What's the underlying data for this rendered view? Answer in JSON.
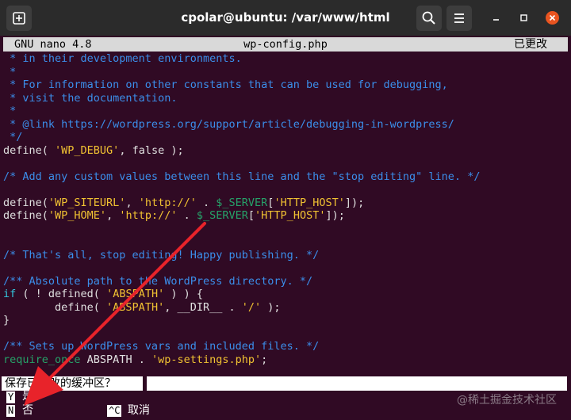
{
  "window": {
    "title": "cpolar@ubuntu: /var/www/html",
    "icons": [
      "new-tab-icon",
      "search-icon",
      "hamburger-menu-icon",
      "minimize-icon",
      "maximize-icon",
      "close-icon"
    ]
  },
  "nano": {
    "version": "GNU nano 4.8",
    "filename": "wp-config.php",
    "modified": "已更改"
  },
  "code_lines": [
    {
      "parts": [
        {
          "c": "cm",
          "t": " * in their development environments."
        }
      ]
    },
    {
      "parts": [
        {
          "c": "cm",
          "t": " *"
        }
      ]
    },
    {
      "parts": [
        {
          "c": "cm",
          "t": " * For information on other constants that can be used for debugging,"
        }
      ]
    },
    {
      "parts": [
        {
          "c": "cm",
          "t": " * visit the documentation."
        }
      ]
    },
    {
      "parts": [
        {
          "c": "cm",
          "t": " *"
        }
      ]
    },
    {
      "parts": [
        {
          "c": "cm",
          "t": " * @link https://wordpress.org/support/article/debugging-in-wordpress/"
        }
      ]
    },
    {
      "parts": [
        {
          "c": "cm",
          "t": " */"
        }
      ]
    },
    {
      "parts": [
        {
          "c": "kw",
          "t": "define( "
        },
        {
          "c": "st",
          "t": "'WP_DEBUG'"
        },
        {
          "c": "kw",
          "t": ", false );"
        }
      ]
    },
    {
      "parts": [
        {
          "c": "kw",
          "t": ""
        }
      ]
    },
    {
      "parts": [
        {
          "c": "cm",
          "t": "/* Add any custom values between this line and the \"stop editing\" line. */"
        }
      ]
    },
    {
      "parts": [
        {
          "c": "kw",
          "t": ""
        }
      ]
    },
    {
      "parts": [
        {
          "c": "kw",
          "t": "define("
        },
        {
          "c": "st",
          "t": "'WP_SITEURL'"
        },
        {
          "c": "kw",
          "t": ", "
        },
        {
          "c": "st",
          "t": "'http://'"
        },
        {
          "c": "kw",
          "t": " . "
        },
        {
          "c": "vr",
          "t": "$_SERVER"
        },
        {
          "c": "kw",
          "t": "["
        },
        {
          "c": "st",
          "t": "'HTTP_HOST'"
        },
        {
          "c": "kw",
          "t": "]);"
        }
      ]
    },
    {
      "parts": [
        {
          "c": "kw",
          "t": "define("
        },
        {
          "c": "st",
          "t": "'WP_HOME'"
        },
        {
          "c": "kw",
          "t": ", "
        },
        {
          "c": "st",
          "t": "'http://'"
        },
        {
          "c": "kw",
          "t": " . "
        },
        {
          "c": "vr",
          "t": "$_SERVER"
        },
        {
          "c": "kw",
          "t": "["
        },
        {
          "c": "st",
          "t": "'HTTP_HOST'"
        },
        {
          "c": "kw",
          "t": "]);"
        }
      ]
    },
    {
      "parts": [
        {
          "c": "kw",
          "t": ""
        }
      ]
    },
    {
      "parts": [
        {
          "c": "kw",
          "t": ""
        }
      ]
    },
    {
      "parts": [
        {
          "c": "cm",
          "t": "/* That's all, stop editing! Happy publishing. */"
        }
      ]
    },
    {
      "parts": [
        {
          "c": "kw",
          "t": ""
        }
      ]
    },
    {
      "parts": [
        {
          "c": "cm",
          "t": "/** Absolute path to the WordPress directory. */"
        }
      ]
    },
    {
      "parts": [
        {
          "c": "vr2",
          "t": "if"
        },
        {
          "c": "kw",
          "t": " ( ! defined( "
        },
        {
          "c": "st",
          "t": "'ABSPATH'"
        },
        {
          "c": "kw",
          "t": " ) ) {"
        }
      ]
    },
    {
      "parts": [
        {
          "c": "kw",
          "t": "        define( "
        },
        {
          "c": "st",
          "t": "'ABSPATH'"
        },
        {
          "c": "kw",
          "t": ", __DIR__ . "
        },
        {
          "c": "st",
          "t": "'/'"
        },
        {
          "c": "kw",
          "t": " );"
        }
      ]
    },
    {
      "parts": [
        {
          "c": "kw",
          "t": "}"
        }
      ]
    },
    {
      "parts": [
        {
          "c": "kw",
          "t": ""
        }
      ]
    },
    {
      "parts": [
        {
          "c": "cm",
          "t": "/** Sets up WordPress vars and included files. */"
        }
      ]
    },
    {
      "parts": [
        {
          "c": "vr",
          "t": "require_once"
        },
        {
          "c": "kw",
          "t": " ABSPATH . "
        },
        {
          "c": "st",
          "t": "'wp-settings.php'"
        },
        {
          "c": "kw",
          "t": ";"
        }
      ]
    }
  ],
  "prompt": {
    "question": "保存已修改的缓冲区？",
    "options": [
      {
        "key": "Y",
        "label": "是"
      },
      {
        "key": "N",
        "label": "否"
      },
      {
        "key": "^C",
        "label": "取消"
      }
    ]
  },
  "watermark": "@稀土掘金技术社区",
  "colors": {
    "background": "#300a24",
    "titlebar": "#2b2b2b",
    "comment": "#3b8eea",
    "string": "#f1c232",
    "arrow": "#e8232a"
  }
}
